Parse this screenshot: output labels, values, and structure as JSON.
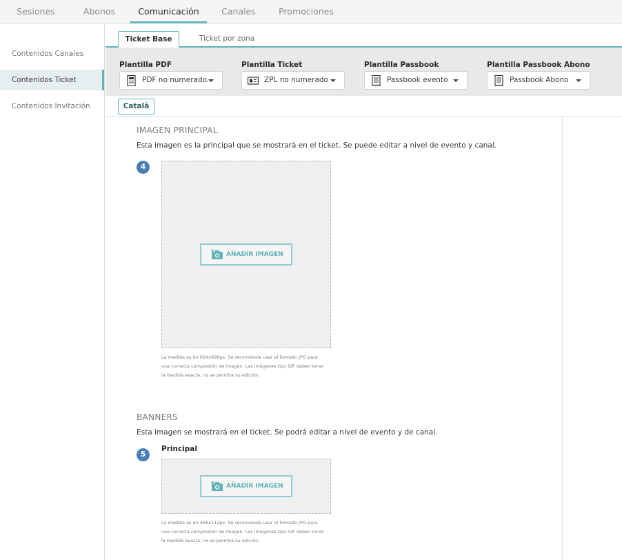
{
  "topnav": {
    "tabs": [
      {
        "label": "Sesiones"
      },
      {
        "label": "Abonos"
      },
      {
        "label": "Comunicación"
      },
      {
        "label": "Canales"
      },
      {
        "label": "Promociones"
      }
    ]
  },
  "sidebar": {
    "items": [
      {
        "label": "Contenidos Canales"
      },
      {
        "label": "Contenidos Ticket"
      },
      {
        "label": "Contenidos Invitación"
      }
    ]
  },
  "subtabs": [
    {
      "label": "Ticket Base"
    },
    {
      "label": "Ticket por zona"
    }
  ],
  "templates": [
    {
      "label": "Plantilla PDF",
      "value": "PDF no numerado.",
      "icon": "document-icon"
    },
    {
      "label": "Plantilla Ticket",
      "value": "ZPL no numerado",
      "icon": "ticket-printer-icon"
    },
    {
      "label": "Plantilla Passbook",
      "value": "Passbook evento",
      "icon": "passbook-icon"
    },
    {
      "label": "Plantilla Passbook Abono",
      "value": "Passbook Abono",
      "icon": "passbook-icon"
    }
  ],
  "language": {
    "label": "Català"
  },
  "main_image": {
    "title": "IMAGEN PRINCIPAL",
    "description": "Esta imagen es la principal que se mostrará en el ticket. Se puede editar a nivel de evento y canal.",
    "step": "4",
    "button": "AÑADIR IMAGEN",
    "hint": [
      "La medida es de 624x696px. Se recomienda usar el formato JPG para",
      "una correcta compresión de imagen. Las imágenes tipo GIF deben tener",
      "la medida exacta, no se permite su edición."
    ]
  },
  "banners": {
    "title": "BANNERS",
    "description": "Esta imagen se mostrará en el ticket. Se podrá editar a nivel de evento y de canal.",
    "step": "5",
    "sub_label": "Principal",
    "button": "AÑADIR IMAGEN",
    "hint": [
      "La medida es de 456x112px. Se recomienda usar el formato JPG para",
      "una correcta compresión de imagen. Las imágenes tipo GIF deben tener",
      "la medida exacta, no se permite su edición."
    ]
  },
  "colors": {
    "accent": "#5fb3b9",
    "step_badge": "#4a7fb5"
  }
}
